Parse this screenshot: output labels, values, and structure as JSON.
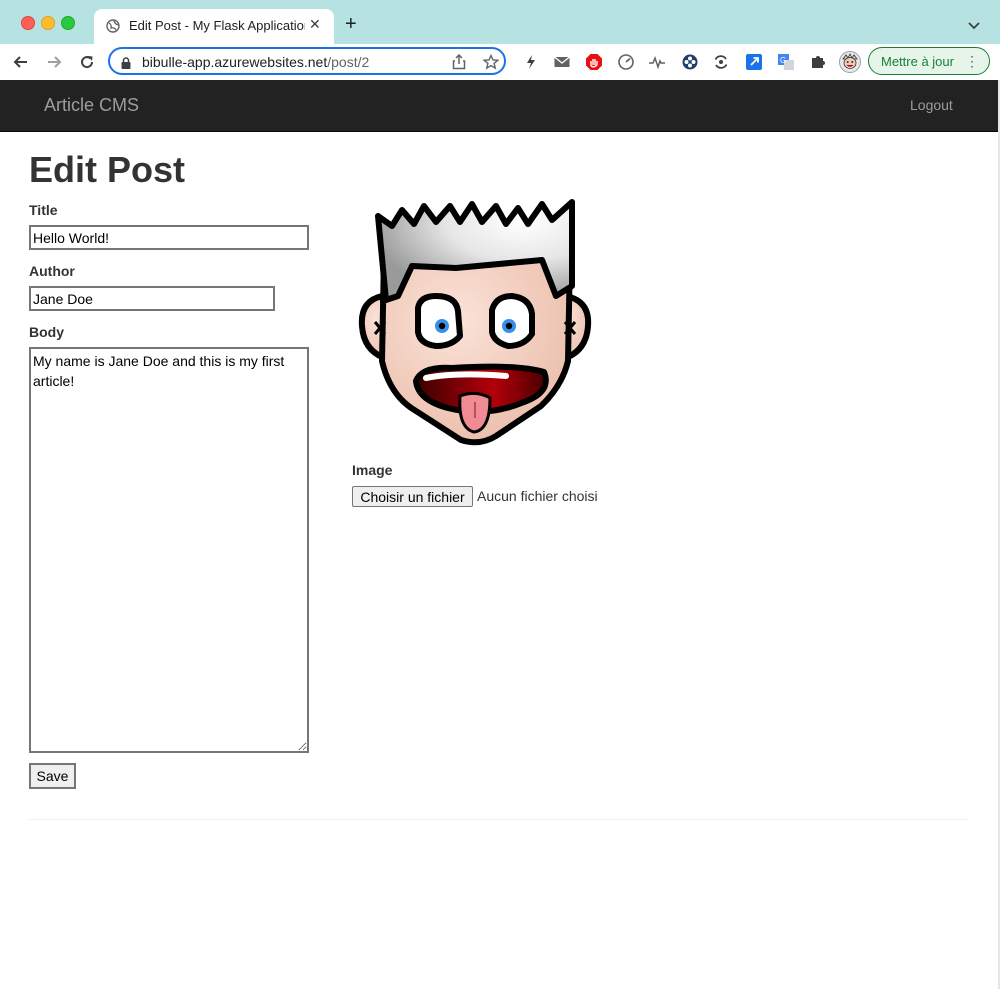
{
  "browser": {
    "tab_title": "Edit Post - My Flask Application",
    "tab_close": "✕",
    "new_tab": "+",
    "url_host": "bibulle-app.azurewebsites.net",
    "url_path": "/post/2",
    "update_label": "Mettre à jour",
    "menu_dots": "⋮",
    "extensions": [
      "bolt-icon",
      "mail-icon",
      "shield-icon",
      "speed-icon",
      "pulse-icon",
      "flower-icon",
      "sync-icon",
      "external-link-icon",
      "translate-icon",
      "puzzle-icon",
      "profile-avatar"
    ]
  },
  "navbar": {
    "brand": "Article CMS",
    "logout": "Logout"
  },
  "form": {
    "heading": "Edit Post",
    "title_label": "Title",
    "title_value": "Hello World!",
    "author_label": "Author",
    "author_value": "Jane Doe",
    "body_label": "Body",
    "body_value": "My name is Jane Doe and this is my first article!",
    "image_label": "Image",
    "file_button": "Choisir un fichier",
    "file_status": "Aucun fichier choisi",
    "save_label": "Save"
  },
  "colors": {
    "tab_strip": "#b6e3e1",
    "navbar_bg": "#222222",
    "navbar_text": "#9d9d9d",
    "focus_ring": "#1a73e8",
    "update_green": "#188038"
  }
}
